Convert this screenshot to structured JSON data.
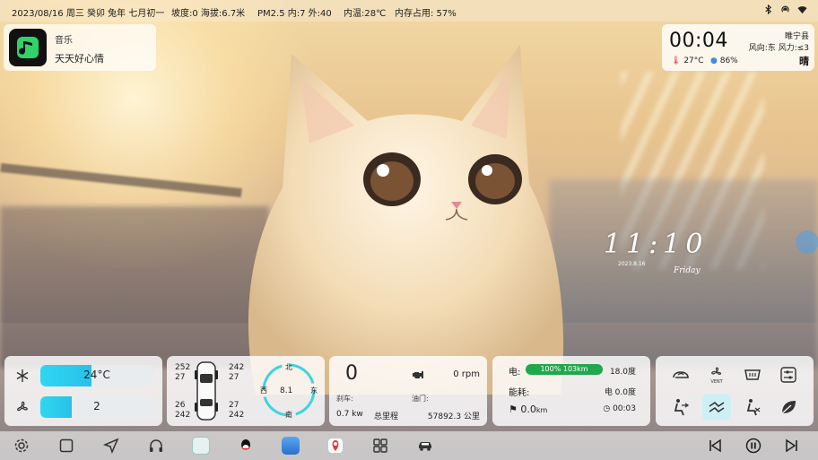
{
  "status_bar": {
    "date_text": "2023/08/16 周三 癸卯 兔年 七月初一",
    "slope_text": "坡度:0 海拔:6.7米",
    "air_text": "PM2.5 内:7 外:40",
    "cabin_temp_text": "内温:28℃",
    "memory_text": "内存占用: 57%",
    "icons": [
      "bluetooth-icon",
      "hotspot-icon",
      "wifi-icon"
    ]
  },
  "music": {
    "label": "音乐",
    "song": "天天好心情"
  },
  "weather": {
    "time": "00:04",
    "city": "睢宁县",
    "wind": "风向:东  风力:≤3",
    "temperature": "27°C",
    "humidity": "86%",
    "condition": "晴"
  },
  "hand_clock": {
    "time": "11:10",
    "date": "2023.8.16",
    "day": "Friday"
  },
  "climate": {
    "temperature": "24°C",
    "temperature_level": 0.45,
    "fan": "2",
    "fan_level": 0.28
  },
  "car_status": {
    "front_left": {
      "pressure": "252",
      "temp": "27"
    },
    "front_right": {
      "pressure": "242",
      "temp": "27"
    },
    "rear_left": {
      "pressure": "26",
      "temp": "242"
    },
    "rear_right": {
      "pressure": "27",
      "temp": "242"
    },
    "compass": {
      "north": "北",
      "south": "南",
      "west": "西",
      "east": "东",
      "value": "8.1"
    }
  },
  "drive": {
    "speed": "0",
    "rpm": "0 rpm",
    "brake_label": "刹车:",
    "brake_value": "0.7 kw",
    "throttle_label": "油门:",
    "mileage_label": "总里程",
    "mileage_value": "57892.3 公里"
  },
  "energy": {
    "battery_label": "电:",
    "battery_bar": "100% 103km",
    "battery_consumption": "18.0度",
    "energy_label": "能耗:",
    "energy_value": "电 0.0度",
    "trip_value": "0.0",
    "trip_unit": "km",
    "trip_time": "00:03"
  },
  "controls": {
    "vent_label": "VENT",
    "buttons": [
      "ac-recirc-icon",
      "vent-fan-icon",
      "windshield-defrost-icon",
      "settings-slider-icon",
      "seat-face-air-icon",
      "seat-face-feet-air-icon",
      "seat-feet-air-icon",
      "eco-leaf-icon"
    ]
  },
  "dock": {
    "items": [
      "settings-icon",
      "window-icon",
      "navigation-icon",
      "headphones-icon",
      "app-chat-icon",
      "qq-icon",
      "weather-app-icon",
      "map-pin-app-icon",
      "apps-grid-icon",
      "car-icon"
    ],
    "media": [
      "previous-icon",
      "pause-icon",
      "next-icon"
    ]
  }
}
